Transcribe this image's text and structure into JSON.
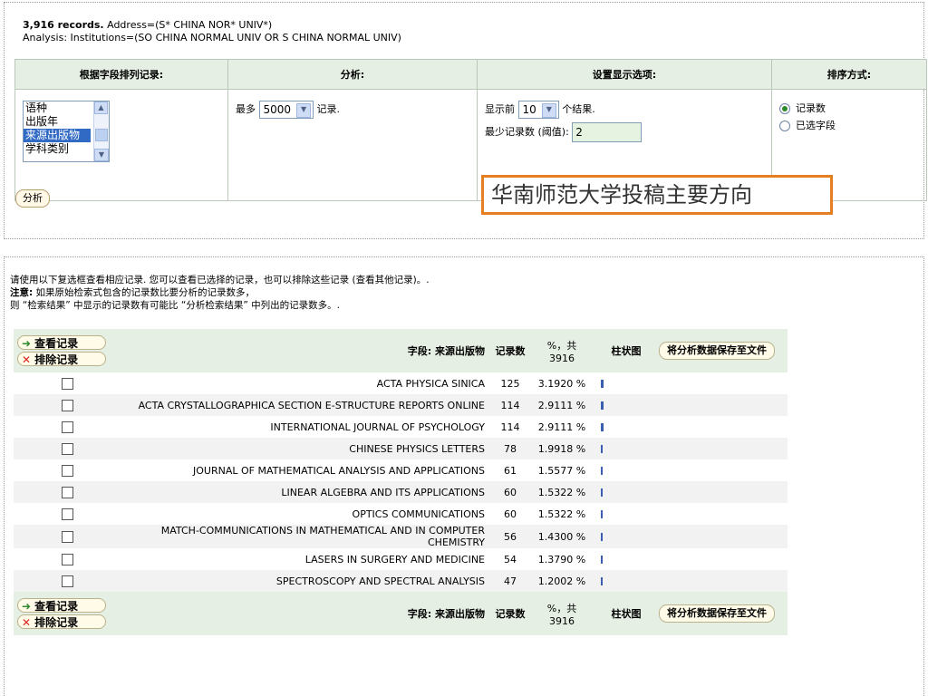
{
  "summary": {
    "records": "3,916 records.",
    "address": " Address=(S* CHINA NOR* UNIV*)",
    "analysis": "Analysis: Institutions=(SO CHINA NORMAL UNIV OR S CHINA NORMAL UNIV)"
  },
  "options_table": {
    "headers": [
      "根据字段排列记录:",
      "分析:",
      "设置显示选项:",
      "排序方式:"
    ],
    "field_list": [
      "语种",
      "出版年",
      "来源出版物",
      "学科类别"
    ],
    "field_selected": "来源出版物",
    "analyze_prefix": "最多",
    "analyze_max": "5000",
    "analyze_suffix": "记录.",
    "show_prefix": "显示前",
    "show_top": "10",
    "show_suffix": "个结果.",
    "min_label": "最少记录数 (阈值):",
    "min_value": "2",
    "sort_options": [
      "记录数",
      "已选字段"
    ]
  },
  "analyze_button": "分析",
  "callout": "华南师范大学投稿主要方向",
  "notes": {
    "line1": "请使用以下复选框查看相应记录. 您可以查看已选择的记录，也可以排除这些记录 (查看其他记录)。.",
    "line2_bold": "注意:",
    "line2": " 如果原始检索式包含的记录数比要分析的记录数多，",
    "line3": "则 “检索结果” 中显示的记录数有可能比 “分析检索结果” 中列出的记录数多。."
  },
  "results": {
    "view_button": "查看记录",
    "exclude_button": "排除记录",
    "field_header": "字段: 来源出版物",
    "count_header": "记录数",
    "pct_header_1": "%，共",
    "pct_header_2": "3916",
    "chart_header": "柱状图",
    "save_button": "将分析数据保存至文件",
    "rows": [
      {
        "name": "ACTA PHYSICA SINICA",
        "count": "125",
        "pct": "3.1920 %"
      },
      {
        "name": "ACTA CRYSTALLOGRAPHICA SECTION E-STRUCTURE REPORTS ONLINE",
        "count": "114",
        "pct": "2.9111 %"
      },
      {
        "name": "INTERNATIONAL JOURNAL OF PSYCHOLOGY",
        "count": "114",
        "pct": "2.9111 %"
      },
      {
        "name": "CHINESE PHYSICS LETTERS",
        "count": "78",
        "pct": "1.9918 %"
      },
      {
        "name": "JOURNAL OF MATHEMATICAL ANALYSIS AND APPLICATIONS",
        "count": "61",
        "pct": "1.5577 %"
      },
      {
        "name": "LINEAR ALGEBRA AND ITS APPLICATIONS",
        "count": "60",
        "pct": "1.5322 %"
      },
      {
        "name": "OPTICS COMMUNICATIONS",
        "count": "60",
        "pct": "1.5322 %"
      },
      {
        "name": "MATCH-COMMUNICATIONS IN MATHEMATICAL AND IN COMPUTER CHEMISTRY",
        "count": "56",
        "pct": "1.4300 %"
      },
      {
        "name": "LASERS IN SURGERY AND MEDICINE",
        "count": "54",
        "pct": "1.3790 %"
      },
      {
        "name": "SPECTROSCOPY AND SPECTRAL ANALYSIS",
        "count": "47",
        "pct": "1.2002 %"
      }
    ]
  },
  "colors": {
    "accent": "#e67e22",
    "header_bg": "#e6efe3",
    "bar": "#3a5fb0"
  }
}
